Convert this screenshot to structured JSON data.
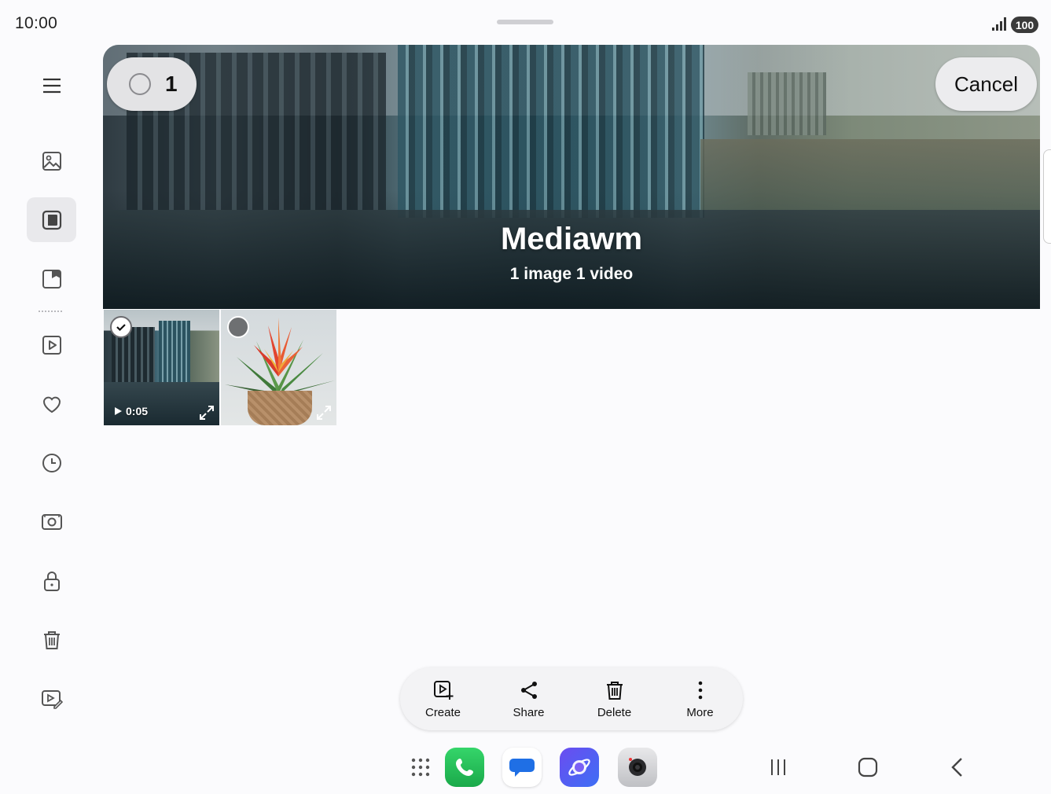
{
  "status_bar": {
    "time": "10:00",
    "battery": "100",
    "signal_icon": "signal-icon"
  },
  "sidebar": {
    "items": [
      {
        "name": "menu-icon"
      },
      {
        "name": "pictures-icon"
      },
      {
        "name": "albums-icon",
        "active": true
      },
      {
        "name": "stories-icon"
      },
      {
        "name": "videos-icon"
      },
      {
        "name": "favorites-icon"
      },
      {
        "name": "recent-icon"
      },
      {
        "name": "screenshots-icon"
      },
      {
        "name": "secure-folder-icon"
      },
      {
        "name": "trash-icon"
      },
      {
        "name": "editing-icon"
      }
    ]
  },
  "selection": {
    "count": "1",
    "cancel_label": "Cancel"
  },
  "album": {
    "title": "Mediawm",
    "subtitle": "1 image 1 video"
  },
  "thumbnails": [
    {
      "type": "video",
      "duration": "0:05",
      "selected": true
    },
    {
      "type": "image",
      "selected": false
    }
  ],
  "actions": {
    "create": "Create",
    "share": "Share",
    "delete": "Delete",
    "more": "More"
  },
  "taskbar": {
    "apps": [
      "apps-grid-icon",
      "phone-icon",
      "messages-icon",
      "internet-icon",
      "camera-icon"
    ],
    "nav": [
      "recents-icon",
      "home-icon",
      "back-icon"
    ]
  },
  "colors": {
    "background": "#fbfbfd",
    "phone_green": "#1aa94a",
    "messages_blue": "#1f6fe5",
    "browser_purple": "#6b4cf0"
  }
}
